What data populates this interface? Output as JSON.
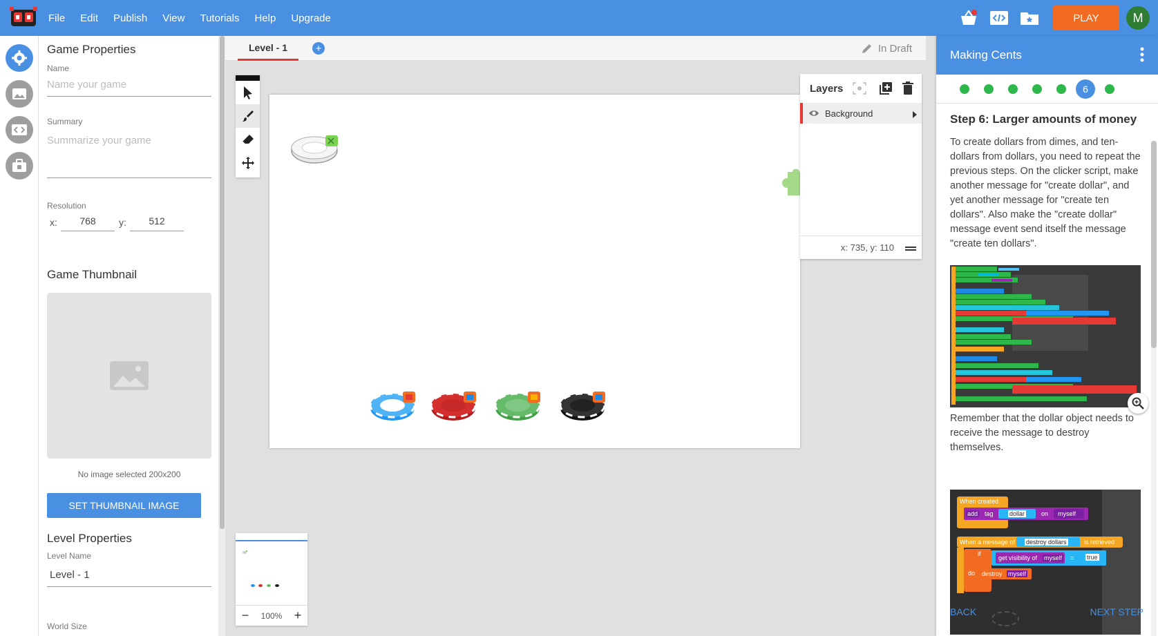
{
  "menu": [
    "File",
    "Edit",
    "Publish",
    "View",
    "Tutorials",
    "Help",
    "Upgrade"
  ],
  "topbar": {
    "play_label": "PLAY",
    "avatar_initial": "M"
  },
  "props": {
    "game_properties_title": "Game Properties",
    "name_label": "Name",
    "name_placeholder": "Name your game",
    "summary_label": "Summary",
    "summary_placeholder": "Summarize your game",
    "resolution_label": "Resolution",
    "res_x_label": "x:",
    "res_x": "768",
    "res_y_label": "y:",
    "res_y": "512",
    "thumbnail_title": "Game Thumbnail",
    "thumbnail_caption": "No image selected 200x200",
    "set_thumbnail_label": "SET THUMBNAIL IMAGE",
    "level_properties_title": "Level Properties",
    "level_name_label": "Level Name",
    "level_name": "Level - 1",
    "world_size_label": "World Size"
  },
  "tabs": {
    "level_tab": "Level - 1",
    "add_symbol": "+",
    "draft_label": "In Draft"
  },
  "layers": {
    "title": "Layers",
    "items": [
      {
        "label": "Background"
      }
    ],
    "coords": "x: 735, y: 110"
  },
  "minimap": {
    "zoom": "100%",
    "minus": "−",
    "plus": "+"
  },
  "tutorial": {
    "title": "Making Cents",
    "current_step": "6",
    "step_title": "Step 6: Larger amounts of money",
    "paragraph1": "To create dollars from dimes, and ten-dollars from dollars, you need to repeat the previous steps. On the clicker script, make another message for \"create dollar\", and yet another message for \"create ten dollars\". Also make the \"create dollar\" message event send itself the message \"create ten dollars\".",
    "paragraph2": "Remember that the dollar object needs to receive the message to destroy themselves.",
    "code2": {
      "when_created": "When created",
      "add": "add",
      "tag": "tag",
      "dollar": "dollar",
      "on": "on",
      "myself": "myself",
      "when_message": "When a message of",
      "destroy_dollars": "destroy dollars",
      "is_retrieved": "is retrieved",
      "if": "if",
      "get_visibility": "get visibility of",
      "eq": "=",
      "true": "true",
      "do": "do",
      "destroy": "destroy"
    },
    "back_label": "BACK",
    "next_label": "NEXT STEP"
  },
  "colors": {
    "brand_blue": "#4a90e2",
    "play_orange": "#f26b22",
    "step_green": "#2eb74b",
    "active_red": "#e53935"
  }
}
